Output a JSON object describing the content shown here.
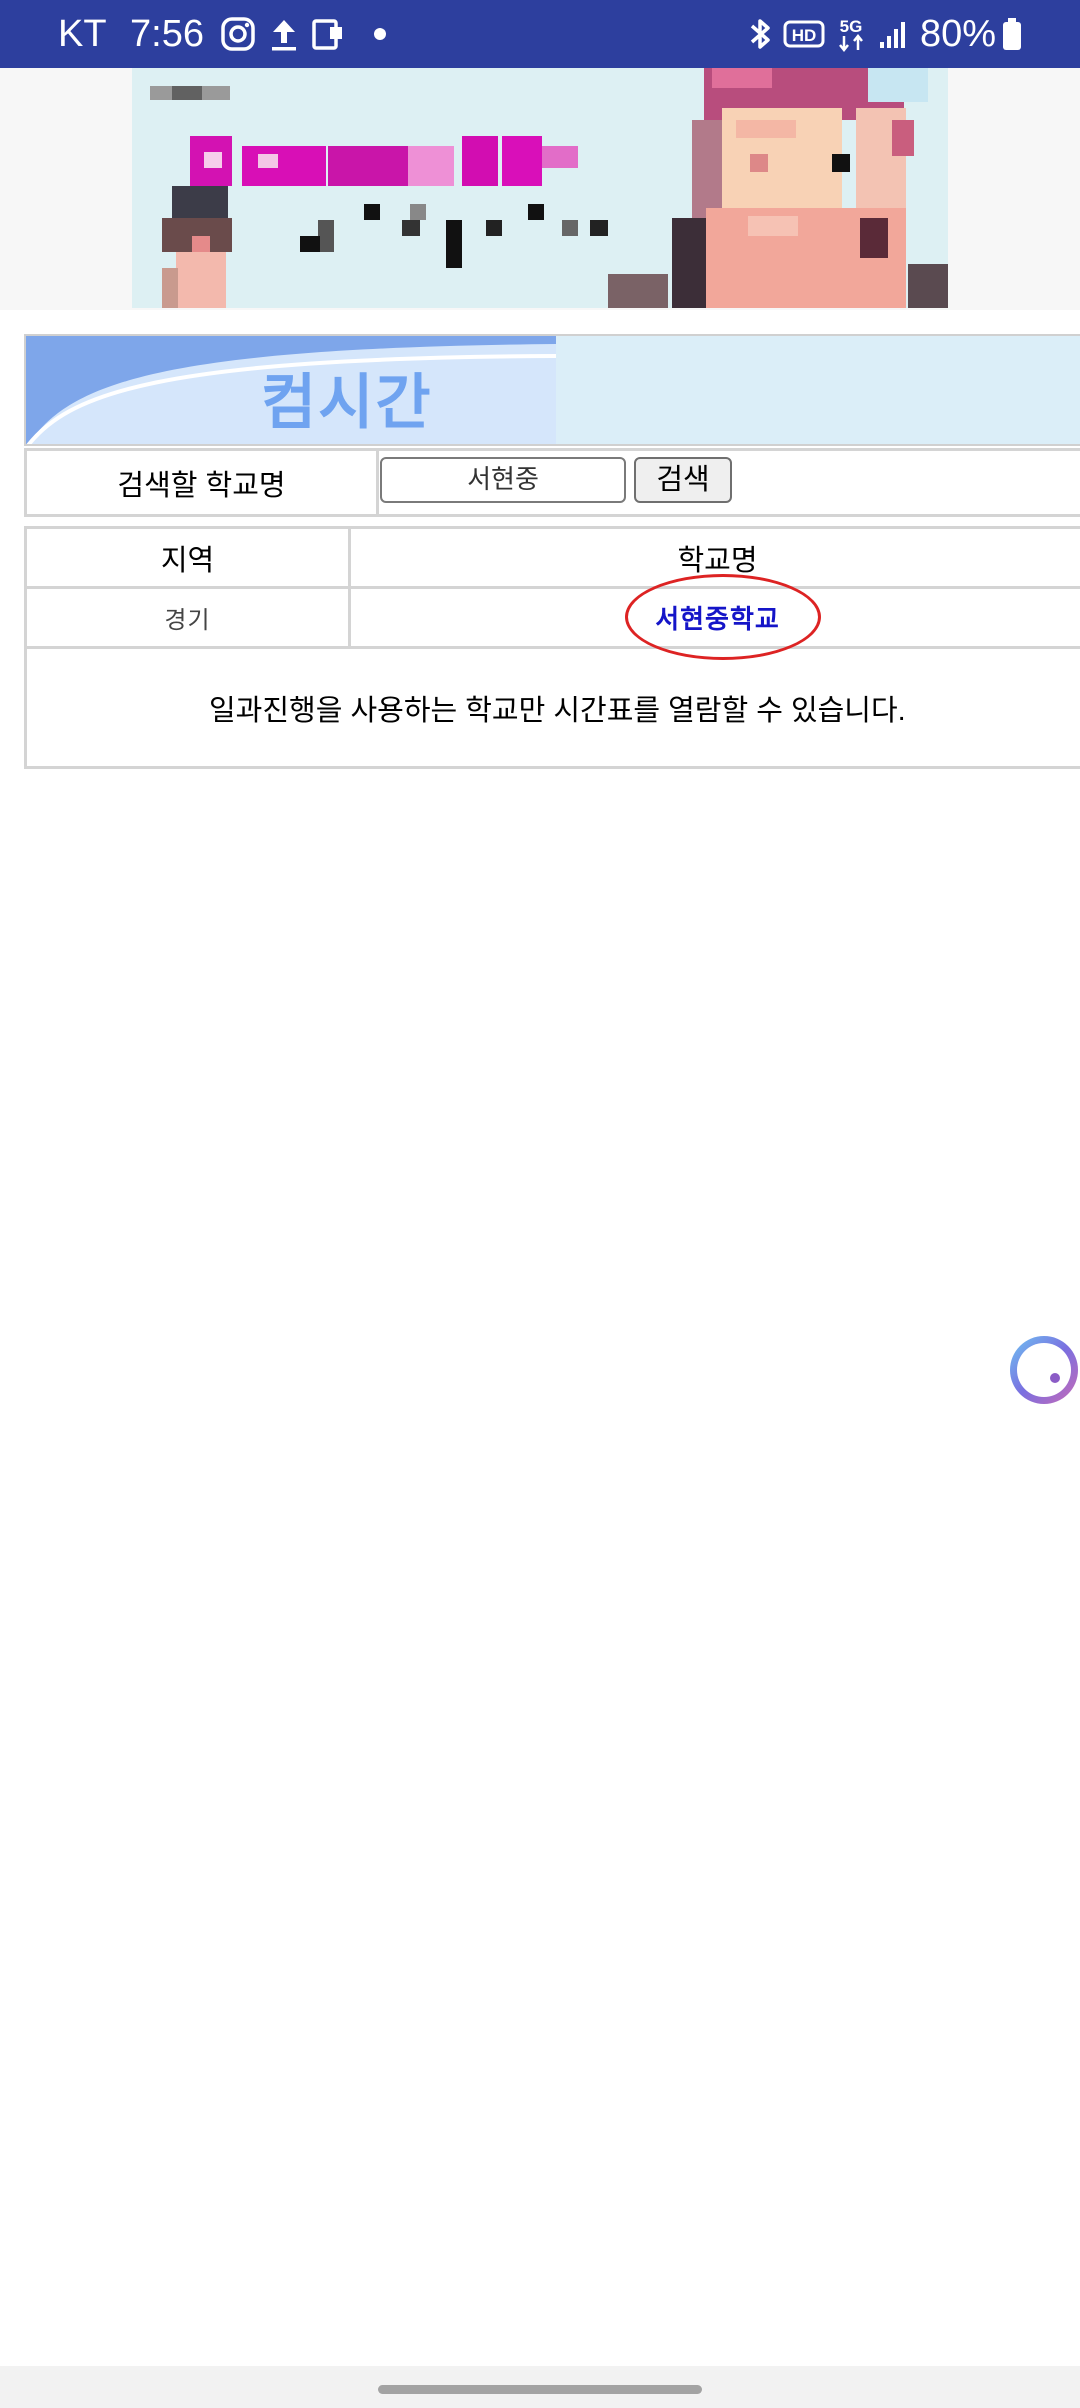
{
  "status_bar": {
    "carrier": "KT",
    "time": "7:56",
    "battery_text": "80%",
    "icons": [
      "instagram-icon",
      "upload-icon",
      "device-icon",
      "dot-icon",
      "bluetooth-icon",
      "hd-voice-icon",
      "5g-icon",
      "signal-icon",
      "battery-icon"
    ]
  },
  "header": {
    "title": "컴시간"
  },
  "search": {
    "label": "검색할 학교명",
    "input_value": "서현중",
    "button_label": "검색"
  },
  "results": {
    "columns": [
      "지역",
      "학교명"
    ],
    "rows": [
      {
        "region": "경기",
        "school": "서현중학교"
      }
    ],
    "note": "일과진행을 사용하는 학교만 시간표를 열람할 수 있습니다."
  },
  "colors": {
    "status_bar": "#2d3f9e",
    "link": "#1515c8",
    "highlight": "#dd2323",
    "header_title": "#6fa3f0"
  }
}
